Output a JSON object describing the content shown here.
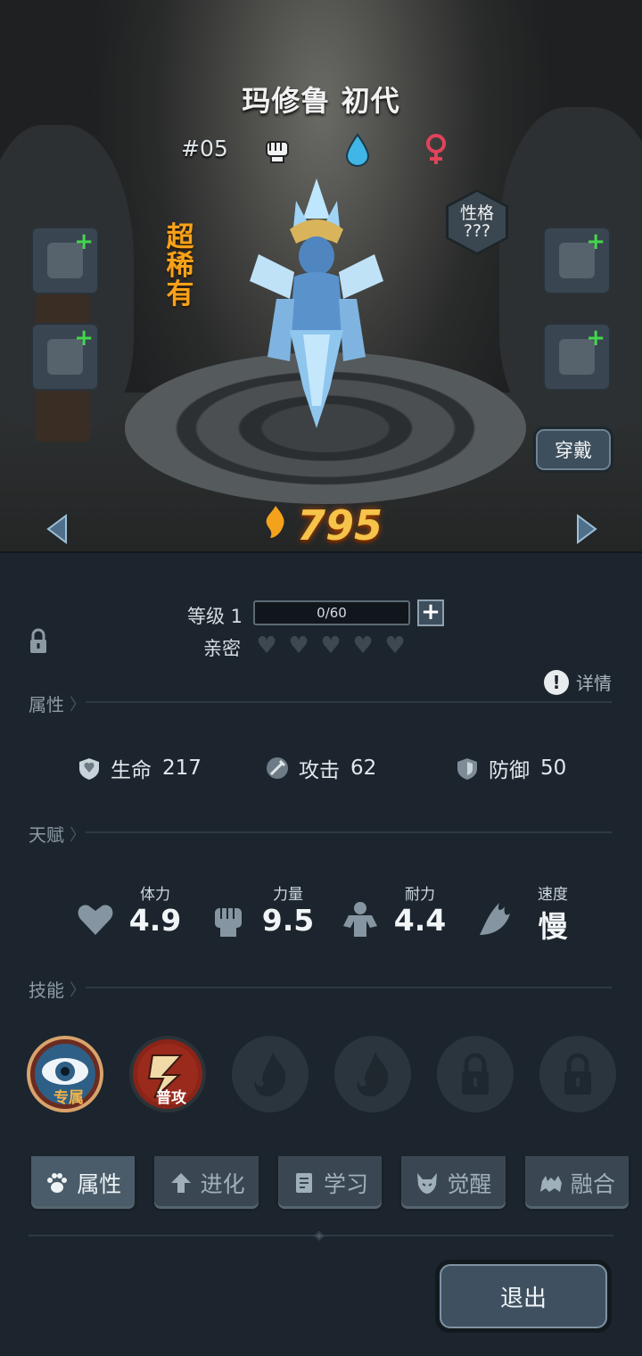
{
  "character": {
    "name": "玛修鲁 初代",
    "number": "#05",
    "rarity": "超稀有",
    "personality_label": "性格",
    "personality_value": "???",
    "power": "795"
  },
  "buttons": {
    "wear": "穿戴",
    "exit": "退出",
    "detail": "详情"
  },
  "level": {
    "label": "等级 1",
    "progress_text": "0/60",
    "progress": 0,
    "plus": "+"
  },
  "intimacy": {
    "label": "亲密",
    "hearts_filled": 0,
    "hearts_total": 5
  },
  "sections": {
    "attributes": "属性",
    "talents": "天赋",
    "skills": "技能"
  },
  "stats": [
    {
      "label": "生命",
      "value": "217",
      "icon": "heart-shield-icon"
    },
    {
      "label": "攻击",
      "value": "62",
      "icon": "sword-icon"
    },
    {
      "label": "防御",
      "value": "50",
      "icon": "shield-icon"
    }
  ],
  "talents": [
    {
      "label": "体力",
      "value": "4.9",
      "icon": "heart-icon"
    },
    {
      "label": "力量",
      "value": "9.5",
      "icon": "fist-icon"
    },
    {
      "label": "耐力",
      "value": "4.4",
      "icon": "muscle-icon"
    },
    {
      "label": "速度",
      "value": "慢",
      "icon": "wing-icon"
    }
  ],
  "skills": [
    {
      "tag": "专属",
      "state": "unlocked",
      "icon": "eye-icon",
      "tag_color": "#f0b24a"
    },
    {
      "tag": "普攻",
      "state": "unlocked",
      "icon": "lightning-icon",
      "tag_color": "#ffffff"
    },
    {
      "tag": "",
      "state": "empty",
      "icon": "flame-icon"
    },
    {
      "tag": "",
      "state": "empty",
      "icon": "flame-icon"
    },
    {
      "tag": "",
      "state": "locked",
      "icon": "lock-icon"
    },
    {
      "tag": "",
      "state": "locked",
      "icon": "lock-icon"
    }
  ],
  "tabs": [
    {
      "label": "属性",
      "icon": "paw-icon",
      "active": true
    },
    {
      "label": "进化",
      "icon": "evolve-arrow-icon",
      "active": false
    },
    {
      "label": "学习",
      "icon": "book-icon",
      "active": false
    },
    {
      "label": "觉醒",
      "icon": "demon-mask-icon",
      "active": false
    },
    {
      "label": "融合",
      "icon": "fusion-beast-icon",
      "active": false
    }
  ],
  "colors": {
    "accent_gold": "#f6c44a",
    "rarity_orange": "#f7a21a",
    "plus_green": "#42d84a",
    "panel_bg": "#1c252d"
  }
}
